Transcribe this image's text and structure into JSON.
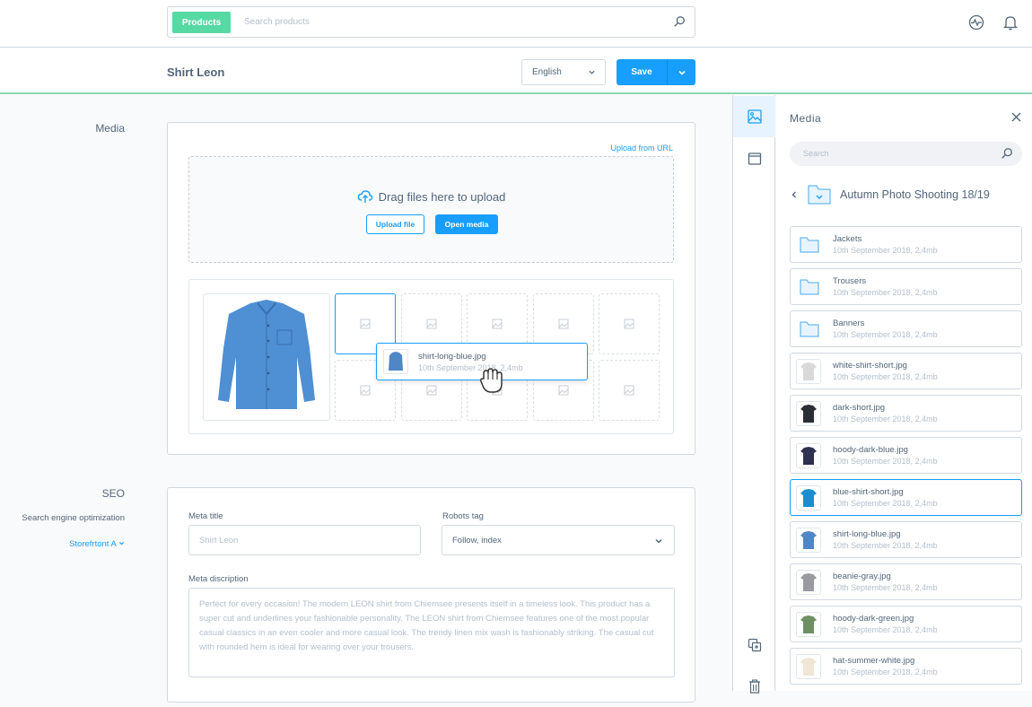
{
  "topbar": {
    "search_module": "Products",
    "search_placeholder": "Search products"
  },
  "smartbar": {
    "title": "Shirt Leon",
    "language": "English",
    "save_label": "Save"
  },
  "media_section": {
    "label": "Media",
    "upload_from_url": "Upload from URL",
    "drag_text": "Drag files here to upload",
    "upload_file": "Upload file",
    "open_media": "Open media"
  },
  "dragging": {
    "name": "shirt-long-blue.jpg",
    "meta": "10th September 2018, 2,4mb"
  },
  "seo_section": {
    "label": "SEO",
    "description": "Search engine optimization",
    "storefront": "Storefrtont A",
    "meta_title_label": "Meta title",
    "meta_title_value": "Shirt Leon",
    "robots_label": "Robots tag",
    "robots_value": "Follow, index",
    "meta_description_label": "Meta discription",
    "meta_description_value": "Perfect for every occasion! The modern LEON shirt from Chiemsee presents itself in a timeless look. This product has a super cut and underlines your fashionable personality. The LEON shirt from Chiemsee features one of the most popular casual classics in an even cooler and more casual look. The trendy linen mix wash is fashionably striking. The casual cut with rounded hem is ideal for wearing over your trousers."
  },
  "media_panel": {
    "title": "Media",
    "search_placeholder": "Search",
    "folder": "Autumn Photo Shooting 18/19",
    "items": [
      {
        "name": "Jackets",
        "meta": "10th September 2018, 2,4mb",
        "type": "folder"
      },
      {
        "name": "Trousers",
        "meta": "10th September 2018, 2,4mb",
        "type": "folder"
      },
      {
        "name": "Banners",
        "meta": "10th September 2018, 2,4mb",
        "type": "folder"
      },
      {
        "name": "white-shirt-short.jpg",
        "meta": "10th September 2018, 2,4mb",
        "type": "image",
        "color": "#d9d9d9"
      },
      {
        "name": "dark-short.jpg",
        "meta": "10th September 2018, 2,4mb",
        "type": "image",
        "color": "#2a2d33"
      },
      {
        "name": "hoody-dark-blue.jpg",
        "meta": "10th September 2018, 2,4mb",
        "type": "image",
        "color": "#2e3250"
      },
      {
        "name": "blue-shirt-short.jpg",
        "meta": "10th September 2018, 2,4mb",
        "type": "image",
        "color": "#1a8ed1",
        "selected": true
      },
      {
        "name": "shirt-long-blue.jpg",
        "meta": "10th September 2018, 2,4mb",
        "type": "image",
        "color": "#4f86c6"
      },
      {
        "name": "beanie-gray.jpg",
        "meta": "10th September 2018, 2,4mb",
        "type": "image",
        "color": "#9a9ba0"
      },
      {
        "name": "hoody-dark-green.jpg",
        "meta": "10th September 2018, 2,4mb",
        "type": "image",
        "color": "#6d8f64"
      },
      {
        "name": "hat-summer-white.jpg",
        "meta": "10th September 2018, 2,4mb",
        "type": "image",
        "color": "#efe6d5"
      }
    ]
  },
  "colors": {
    "accent": "#189eff",
    "module": "#57d9a3",
    "text": "#52667a",
    "muted": "#b3bfcc"
  }
}
